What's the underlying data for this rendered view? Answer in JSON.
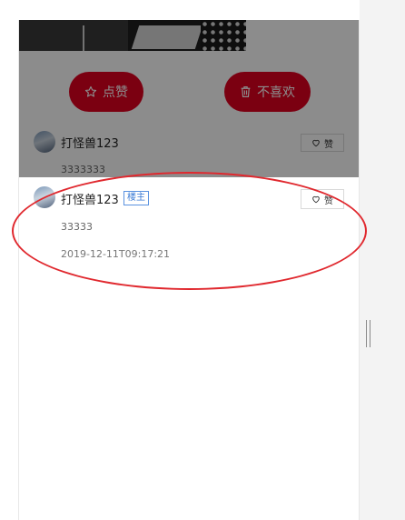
{
  "actions": {
    "like_label": "点赞",
    "dislike_label": "不喜欢",
    "accent": "#e00020"
  },
  "comments": [
    {
      "user": "打怪兽123",
      "text": "3333333",
      "heart_label": "赞"
    },
    {
      "user": "打怪兽123",
      "badge": "楼主",
      "text": "33333",
      "time": "2019-12-11T09:17:21",
      "heart_label": "赞"
    }
  ],
  "annotation_color": "#e0282e"
}
